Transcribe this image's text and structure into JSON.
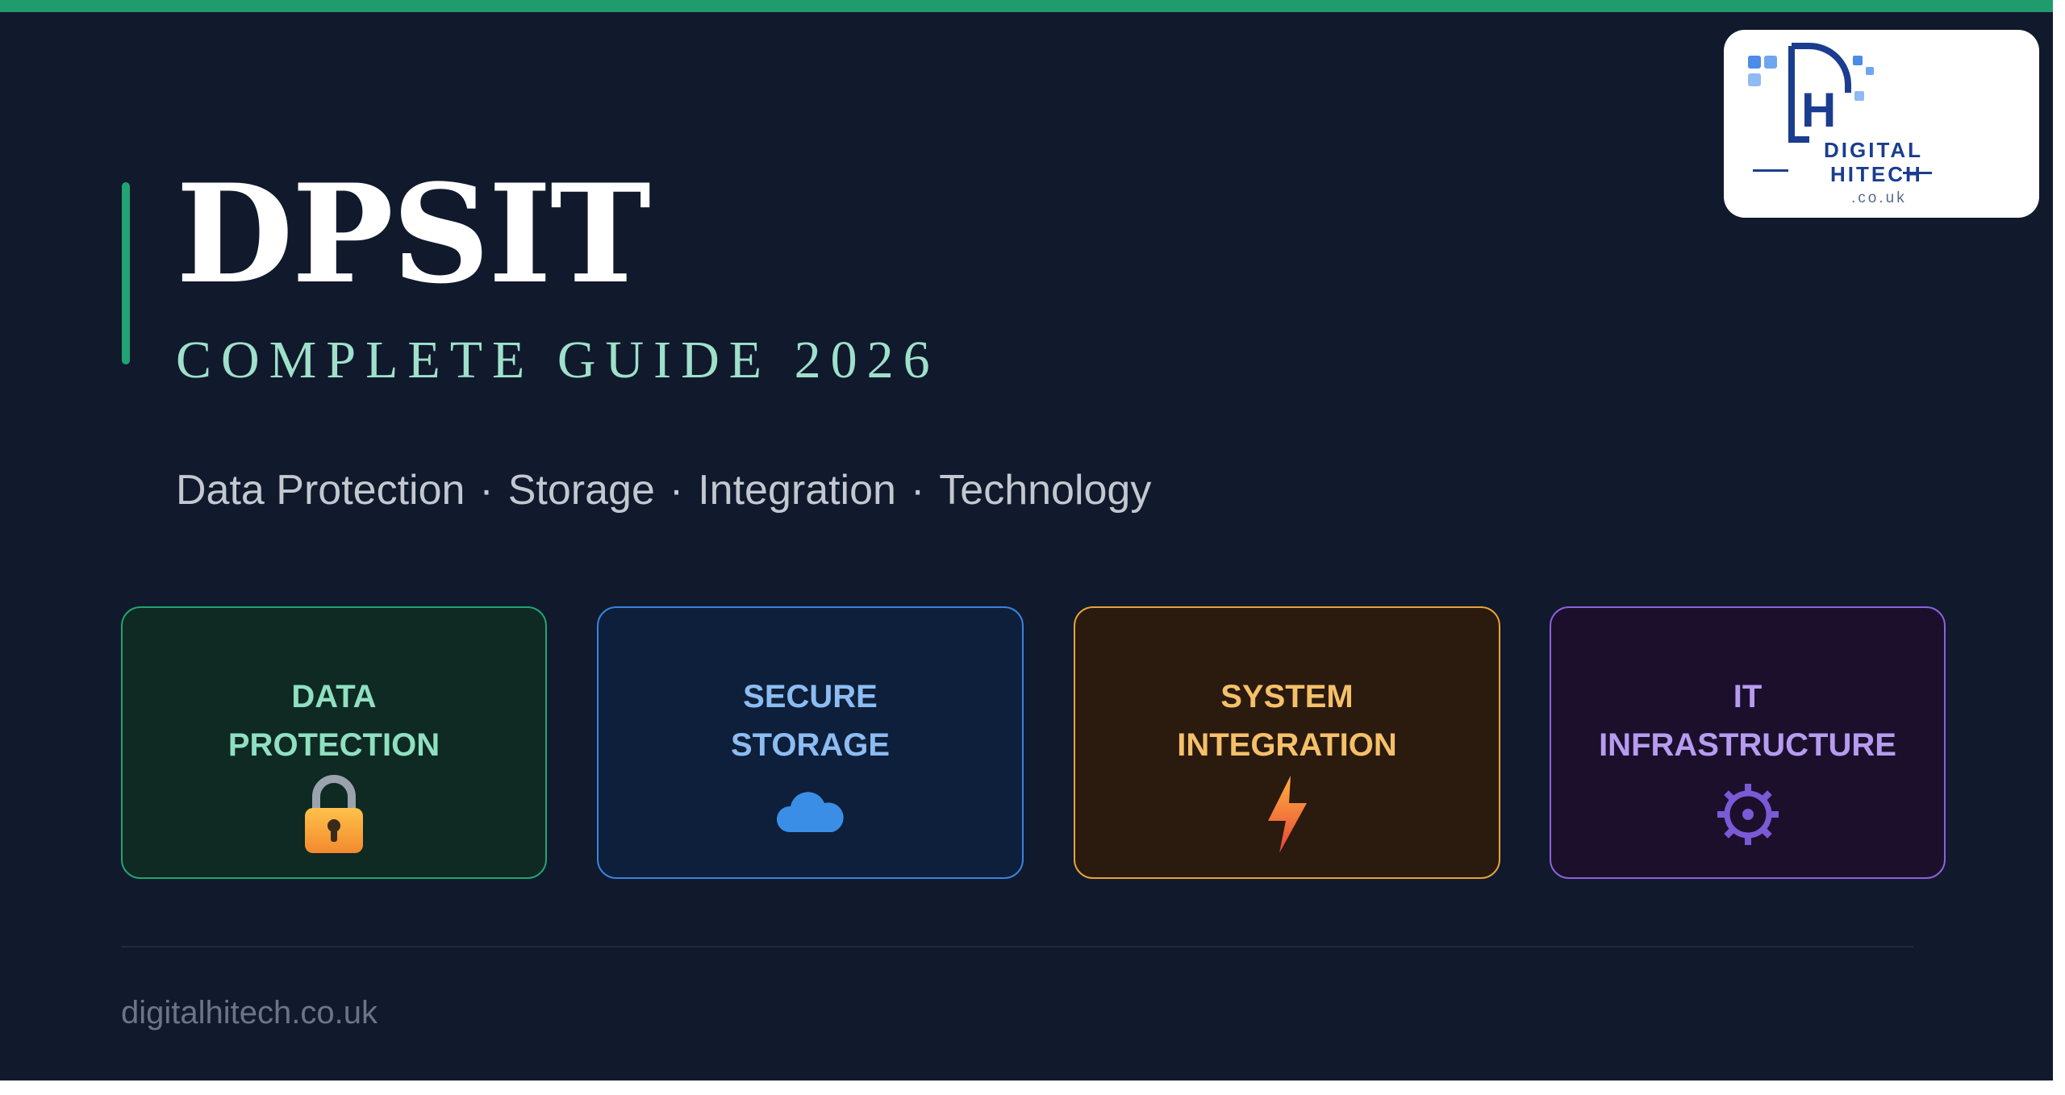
{
  "header": {
    "title": "DPSIT",
    "subtitle": "COMPLETE GUIDE 2026",
    "topics": [
      "Data Protection",
      "Storage",
      "Integration",
      "Technology"
    ],
    "separator": "·"
  },
  "cards": [
    {
      "title": "DATA\nPROTECTION",
      "icon": "lock-icon",
      "accent": "#24a372"
    },
    {
      "title": "SECURE\nSTORAGE",
      "icon": "cloud-icon",
      "accent": "#3b82e0"
    },
    {
      "title": "SYSTEM\nINTEGRATION",
      "icon": "lightning-icon",
      "accent": "#e7a33b"
    },
    {
      "title": "IT\nINFRASTRUCTURE",
      "icon": "gear-icon",
      "accent": "#8c62dc"
    }
  ],
  "footer": {
    "url": "digitalhitech.co.uk"
  },
  "logo": {
    "line1": "DIGITAL",
    "line2": "HITECH",
    "sub": ".co.uk",
    "mark": "H"
  },
  "colors": {
    "background": "#101a2c",
    "top_bar": "#1f9b6e",
    "title": "#ffffff",
    "subtitle": "#9fe0cb"
  }
}
